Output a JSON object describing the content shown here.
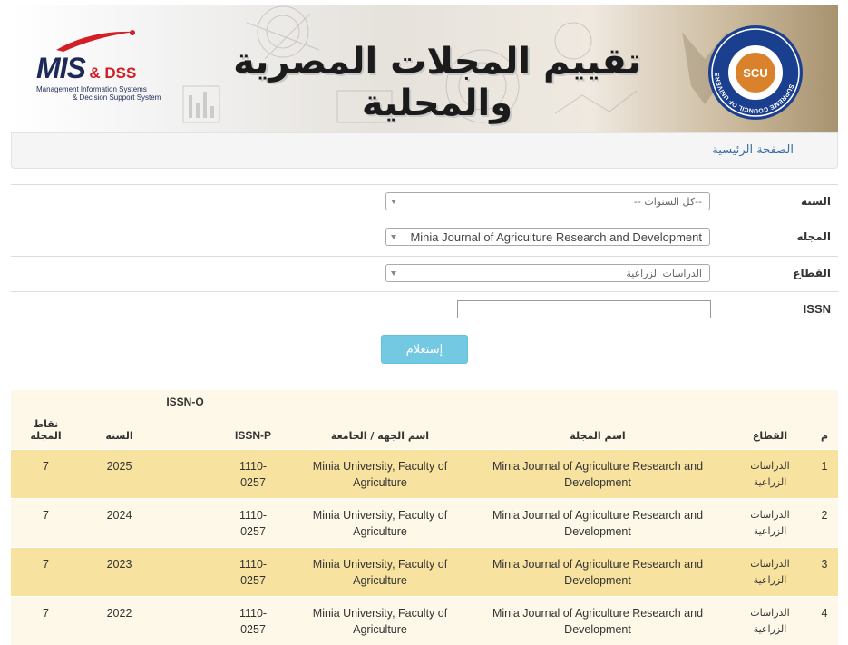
{
  "banner": {
    "title": "تقييم المجلات المصرية والمحلية",
    "logo_main": "MIS",
    "logo_dss": "& DSS",
    "logo_sub1": "Management Information Systems",
    "logo_sub2": "& Decision Support System",
    "seal_center": "SCU",
    "seal_ring": "SUPREME COUNCIL OF UNIVERSITIES"
  },
  "breadcrumb": {
    "home": "الصفحة الرئيسية"
  },
  "form": {
    "year_label": "السنه",
    "year_value": "--كل السنوات --",
    "journal_label": "المجله",
    "journal_value": "Minia Journal of Agriculture Research and Development",
    "sector_label": "القطاع",
    "sector_value": "الدراسات الزراعية",
    "issn_label": "ISSN",
    "issn_value": "",
    "submit_label": "إستعلام"
  },
  "table": {
    "headers": {
      "num": "م",
      "sector": "القطاع",
      "journal": "اسم المجلة",
      "org": "اسم الجهه / الجامعة",
      "issn_p": "ISSN-P",
      "issn_o": "ISSN-O",
      "year": "السنه",
      "points": "نقاط المجله"
    },
    "rows": [
      {
        "num": "1",
        "sector": "الدراسات الزراعية",
        "journal": "Minia Journal of Agriculture Research and Development",
        "org": "Minia University, Faculty of Agriculture",
        "issn_p": "1110-0257",
        "issn_o": "",
        "year": "2025",
        "points": "7"
      },
      {
        "num": "2",
        "sector": "الدراسات الزراعية",
        "journal": "Minia Journal of Agriculture Research and Development",
        "org": "Minia University, Faculty of Agriculture",
        "issn_p": "1110-0257",
        "issn_o": "",
        "year": "2024",
        "points": "7"
      },
      {
        "num": "3",
        "sector": "الدراسات الزراعية",
        "journal": "Minia Journal of Agriculture Research and Development",
        "org": "Minia University, Faculty of Agriculture",
        "issn_p": "1110-0257",
        "issn_o": "",
        "year": "2023",
        "points": "7"
      },
      {
        "num": "4",
        "sector": "الدراسات الزراعية",
        "journal": "Minia Journal of Agriculture Research and Development",
        "org": "Minia University, Faculty of Agriculture",
        "issn_p": "1110-0257",
        "issn_o": "",
        "year": "2022",
        "points": "7"
      }
    ]
  },
  "colors": {
    "accent": "#5bc0de",
    "row_odd": "#f7e2a0",
    "row_even": "#fdf8e7",
    "link": "#3a6ea5"
  }
}
